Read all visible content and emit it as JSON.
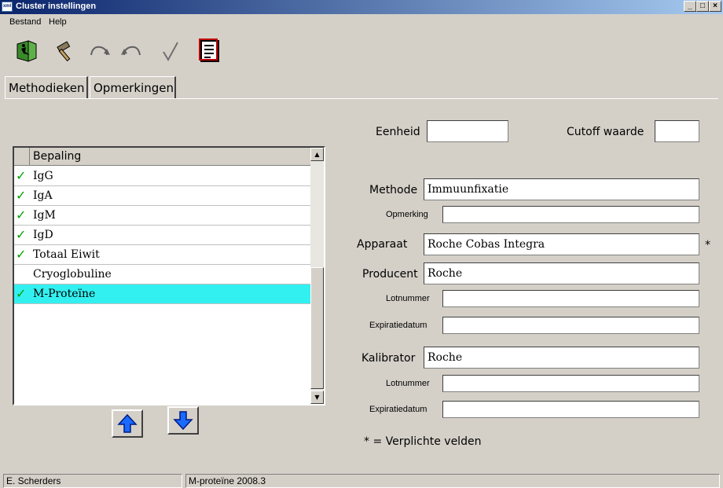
{
  "window": {
    "title": "Cluster instellingen",
    "icon_label": "xml"
  },
  "window_buttons": [
    "_",
    "□",
    "×"
  ],
  "menu": [
    {
      "label": "Bestand"
    },
    {
      "label": "Help"
    }
  ],
  "toolbar": {
    "icons": [
      "exit-icon",
      "hammer-icon",
      "redo-icon",
      "undo-icon",
      "checkmark-icon",
      "report-icon"
    ]
  },
  "tabs": [
    {
      "label": "Methodieken",
      "active": true
    },
    {
      "label": "Opmerkingen",
      "active": false
    }
  ],
  "grid": {
    "column": "Bepaling",
    "rows": [
      {
        "label": "IgG",
        "checked": true
      },
      {
        "label": "IgA",
        "checked": true
      },
      {
        "label": "IgM",
        "checked": true
      },
      {
        "label": "IgD",
        "checked": true
      },
      {
        "label": "Totaal Eiwit",
        "checked": true
      },
      {
        "label": "Cryoglobuline",
        "checked": false
      },
      {
        "label": "M-Proteïne",
        "checked": true,
        "selected": true
      }
    ],
    "check_glyph": "✓",
    "selected_color": "#33f0f0"
  },
  "form": {
    "eenheid_label": "Eenheid",
    "eenheid_value": "",
    "cutoff_label": "Cutoff waarde",
    "cutoff_value": "",
    "methode_label": "Methode",
    "methode_value": "Immuunfixatie",
    "opmerking_label": "Opmerking",
    "opmerking_value": "",
    "apparaat_label": "Apparaat",
    "apparaat_value": "Roche Cobas Integra",
    "required_marker": "*",
    "producent_label": "Producent",
    "producent_value": "Roche",
    "lot1_label": "Lotnummer",
    "lot1_value": "",
    "exp1_label": "Expiratiedatum",
    "exp1_value": "",
    "kalibrator_label": "Kalibrator",
    "kalibrator_value": "Roche",
    "lot2_label": "Lotnummer",
    "lot2_value": "",
    "exp2_label": "Expiratiedatum",
    "exp2_value": "",
    "note": "* = Verplichte velden"
  },
  "status": {
    "user": "E. Scherders",
    "item": "M-proteïne 2008.3"
  }
}
